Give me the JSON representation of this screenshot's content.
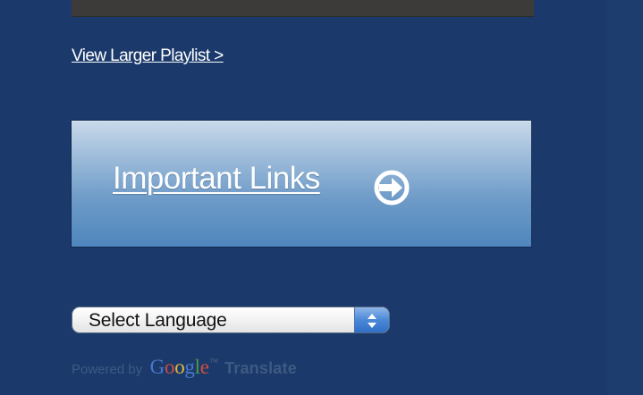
{
  "playlist": {
    "link_text": "View Larger Playlist >"
  },
  "links_panel": {
    "label": "Important Links",
    "icon": "arrow-right-circle-icon"
  },
  "language": {
    "selected": "Select Language"
  },
  "attribution": {
    "powered_by": "Powered by",
    "google_letters": [
      "G",
      "o",
      "o",
      "g",
      "l",
      "e"
    ],
    "trademark": "™",
    "translate": "Translate"
  },
  "colors": {
    "background": "#1b3a6b",
    "panel_top": "#c9d9ea",
    "panel_bottom": "#4f86bd",
    "stepper": "#4b89d8"
  }
}
